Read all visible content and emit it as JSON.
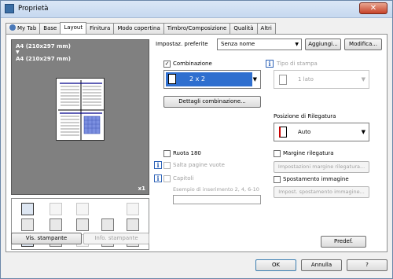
{
  "window": {
    "title": "Proprietà",
    "close_label": "✕"
  },
  "tabs": [
    {
      "label": "My Tab"
    },
    {
      "label": "Base"
    },
    {
      "label": "Layout"
    },
    {
      "label": "Finitura"
    },
    {
      "label": "Modo copertina"
    },
    {
      "label": "Timbro/Composizione"
    },
    {
      "label": "Qualità"
    },
    {
      "label": "Altri"
    }
  ],
  "active_tab": "Layout",
  "preview": {
    "line1": "A4 (210x297 mm)",
    "arrow": "▼",
    "line2": "A4 (210x297 mm)",
    "copies": "x1"
  },
  "favorites": {
    "label": "Impostaz. preferite",
    "value": "Senza nome",
    "add_label": "Aggiungi...",
    "edit_label": "Modifica..."
  },
  "combination": {
    "label": "Combinazione",
    "checked": true,
    "value": "2 x 2",
    "details_label": "Dettagli combinazione..."
  },
  "print_type": {
    "label": "Tipo di stampa",
    "value": "1 lato",
    "enabled": false
  },
  "binding_position": {
    "label": "Posizione di Rilegatura",
    "value": "Auto"
  },
  "rotate180": {
    "label": "Ruota 180",
    "checked": false
  },
  "skip_blank": {
    "label": "Salta pagine vuote",
    "enabled": false
  },
  "chapters": {
    "label": "Capitoli",
    "example": "Esempio di inserimento 2, 4, 6-10",
    "enabled": false
  },
  "binding_margin": {
    "label": "Margine rilegatura",
    "checked": false,
    "settings_label": "Impostazioni margine rilegatura..."
  },
  "image_shift": {
    "label": "Spostamento immagine",
    "checked": false,
    "settings_label": "Impost. spostamento immagine..."
  },
  "buttons": {
    "printer_view": "Vis. stampante",
    "printer_info": "Info. stampante",
    "default": "Predef.",
    "ok": "OK",
    "cancel": "Annulla",
    "help": "?"
  },
  "colors": {
    "accent": "#2f6fcf",
    "preview_bg": "#808080",
    "page_lines": "#00008b",
    "blue_block": "#7b8fe0"
  }
}
